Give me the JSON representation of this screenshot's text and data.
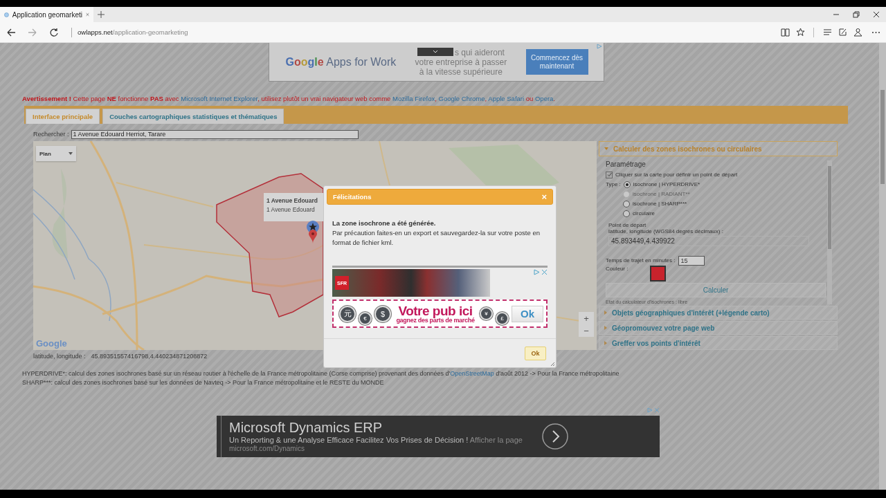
{
  "browser": {
    "tab_title": "Application geomarketi",
    "url_host": "owlapps.net",
    "url_path": "/application-geomarketing"
  },
  "top_ad": {
    "brand": "Google",
    "product": "Apps for Work",
    "lines": [
      "s qui aideront",
      "votre entreprise à passer",
      "à la vitesse supérieure"
    ],
    "button": "Commencez dès maintenant"
  },
  "warning": [
    {
      "kind": "text",
      "text": "**Avertissement !** Cette page **NE** fonctionne **PAS** avec "
    },
    {
      "kind": "link",
      "text": "Microsoft Internet Explorer"
    },
    {
      "kind": "text",
      "text": ", utilisez plutôt un vrai navigateur web comme "
    },
    {
      "kind": "link",
      "text": "Mozilla Firefox"
    },
    {
      "kind": "text",
      "text": ", "
    },
    {
      "kind": "link",
      "text": "Google Chrome"
    },
    {
      "kind": "text",
      "text": ", "
    },
    {
      "kind": "link",
      "text": "Apple Safari"
    },
    {
      "kind": "text",
      "text": " ou "
    },
    {
      "kind": "link",
      "text": "Opera"
    },
    {
      "kind": "text",
      "text": "."
    }
  ],
  "tabs": [
    {
      "label": "Interface principale",
      "selected": true
    },
    {
      "label": "Couches cartographiques statistiques et thématiques",
      "selected": false
    }
  ],
  "search": {
    "label": "Rechercher :",
    "value": "1 Avenue Edouard Herriot, Tarare"
  },
  "map": {
    "map_type": "Plan",
    "popup_title": "1 Avenue Edouard",
    "popup_text": "1 Avenue Edouard",
    "logo": "Google",
    "zoom_in": "+",
    "zoom_out": "−"
  },
  "coordinates": {
    "label": "latitude, longitude :",
    "value": "45.89351557416798,4.440234871208872"
  },
  "panel": {
    "sections": [
      {
        "title": "Calculer des zones isochrones ou circulaires",
        "expanded": true
      },
      {
        "title": "Objets géographiques d'intérêt (+légende carto)",
        "expanded": false
      },
      {
        "title": "Géopromouvez votre page web",
        "expanded": false
      },
      {
        "title": "Greffer vos points d'intérêt",
        "expanded": false
      }
    ],
    "legend": "Paramétrage",
    "checkbox": {
      "label": "Cliquer sur la carte pour définir un point de départ",
      "checked": true
    },
    "type_label": "Type :",
    "radios": [
      {
        "label": "isochrone | HYPERDRIVE*",
        "selected": true,
        "disabled": false
      },
      {
        "label": "isochrone | RADIANT**",
        "selected": false,
        "disabled": true
      },
      {
        "label": "isochrone | SHARP***",
        "selected": false,
        "disabled": false
      },
      {
        "label": "circulaire",
        "selected": false,
        "disabled": false
      }
    ],
    "start_legend": "Point de départ",
    "coord_label": "latitude, longitude (WGS84 degrés décimaux) :",
    "coord_value": "45.893449,4.439922",
    "time_label": "Temps de trajet en minutes :",
    "time_value": "15",
    "couleur": {
      "label": "Couleur :",
      "color": "#c8232c"
    },
    "button": "Calculer",
    "status": "Etat du calculateur d'isochrones : libre"
  },
  "footnotes": [
    [
      {
        "kind": "text",
        "text": "HYPERDRIVE*: calcul des zones isochrones basé sur un réseau routier à l'échelle de la France métropolitaine (Corse comprise) provenant des données d'"
      },
      {
        "kind": "link",
        "text": "OpenStreetMap"
      },
      {
        "kind": "text",
        "text": " d'août 2012 -> Pour la France métropolitaine"
      }
    ],
    [
      {
        "kind": "text",
        "text": "SHARP***: calcul des zones isochrones basé sur les données de Navteq -> Pour la France métropolitaine et le RESTE du MONDE"
      }
    ]
  ],
  "bottom_ad": {
    "title": "Microsoft Dynamics ERP",
    "text": "Un Reporting & une Analyse Efficace Facilitez Vos Prises de Décision !",
    "link": "Afficher la page",
    "url": "microsoft.com/Dynamics"
  },
  "dialog": {
    "title": "Félicitations",
    "close": "×",
    "heading": "La zone isochrone a été générée.",
    "text": "Par précaution faites-en un export et sauvegardez-la sur votre poste en format de fichier kml.",
    "ad": {
      "brand": "SFR",
      "coins_left": [
        "元",
        "€",
        "$"
      ],
      "headline": "Votre pub ici",
      "subline": "gagnez des parts de marché",
      "coins_right": [
        "¥",
        "£"
      ],
      "button": "Ok"
    },
    "ok": "Ok"
  }
}
